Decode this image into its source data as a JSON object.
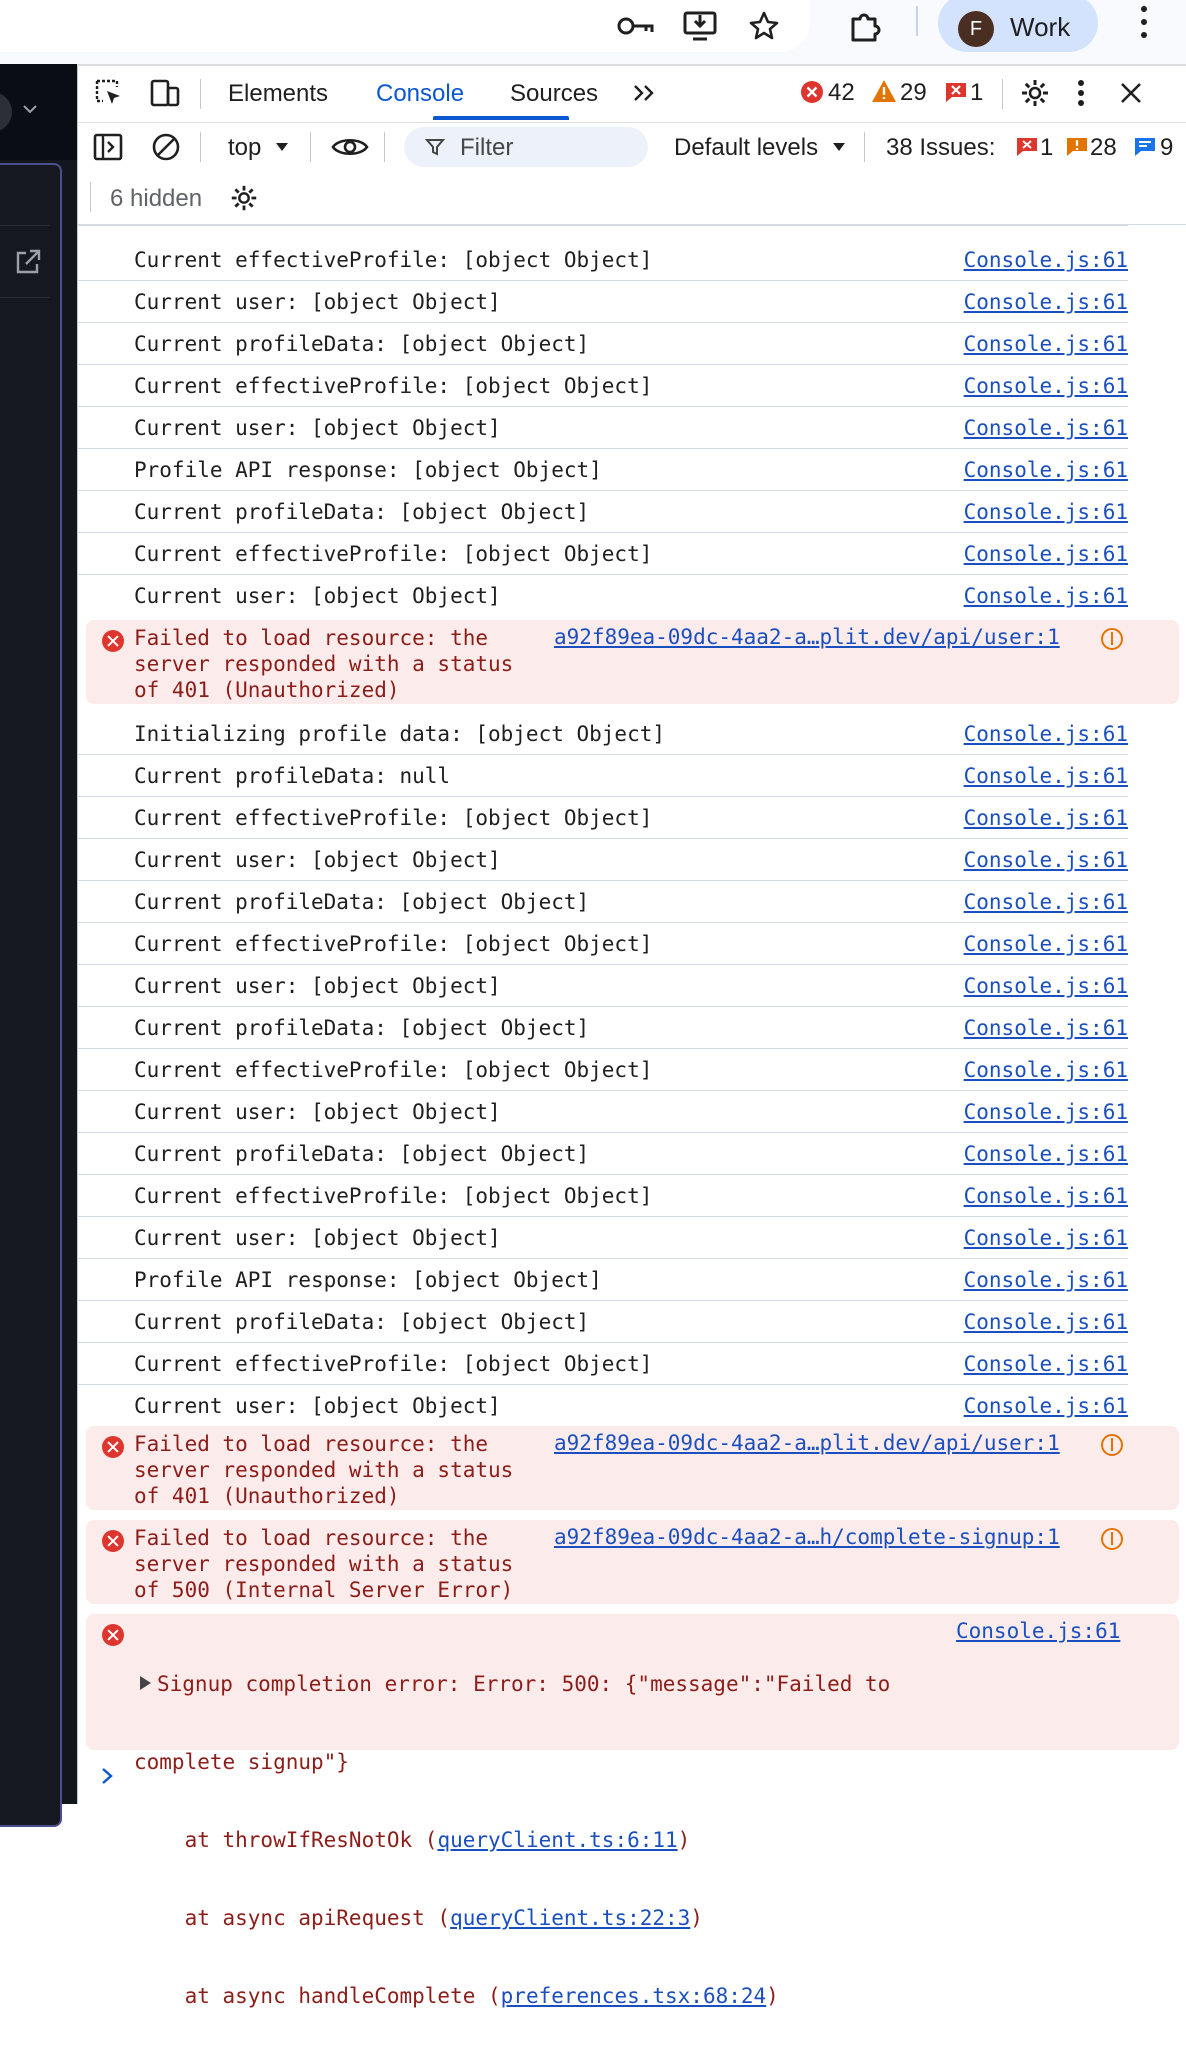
{
  "browser": {
    "profile_initial": "F",
    "profile_name": "Work"
  },
  "devtools": {
    "tabs": [
      "Elements",
      "Console",
      "Sources"
    ],
    "error_count": "42",
    "warning_count": "29",
    "issue_count": "1"
  },
  "toolbar": {
    "context": "top",
    "filter_placeholder": "Filter",
    "levels": "Default levels",
    "issues_label": "38 Issues:",
    "issues_errors": "1",
    "issues_warnings": "28",
    "issues_info": "9",
    "hidden_label": "6 hidden"
  },
  "colors": {
    "accent": "#0b57d0",
    "error_bg": "#fcebeb",
    "error_text": "#8c1d18",
    "error_icon": "#dc362e",
    "warning_icon": "#e37400"
  },
  "console": {
    "rows": [
      {
        "msg": "Current effectiveProfile: [object Object]",
        "src": "Console.js:61"
      },
      {
        "msg": "Current user: [object Object]",
        "src": "Console.js:61"
      },
      {
        "msg": "Current profileData: [object Object]",
        "src": "Console.js:61"
      },
      {
        "msg": "Current effectiveProfile: [object Object]",
        "src": "Console.js:61"
      },
      {
        "msg": "Current user: [object Object]",
        "src": "Console.js:61"
      },
      {
        "msg": "Profile API response: [object Object]",
        "src": "Console.js:61"
      },
      {
        "msg": "Current profileData: [object Object]",
        "src": "Console.js:61"
      },
      {
        "msg": "Current effectiveProfile: [object Object]",
        "src": "Console.js:61"
      },
      {
        "msg": "Current user: [object Object]",
        "src": "Console.js:61"
      }
    ],
    "error1": {
      "line1": "Failed to load resource: the",
      "line2": "server responded with a status",
      "line3": "of 401 (Unauthorized)",
      "src": "a92f89ea-09dc-4aa2-a…plit.dev/api/user:1"
    },
    "rows2": [
      {
        "msg": "Initializing profile data: [object Object]",
        "src": "Console.js:61"
      },
      {
        "msg": "Current profileData: null",
        "src": "Console.js:61"
      },
      {
        "msg": "Current effectiveProfile: [object Object]",
        "src": "Console.js:61"
      },
      {
        "msg": "Current user: [object Object]",
        "src": "Console.js:61"
      },
      {
        "msg": "Current profileData: [object Object]",
        "src": "Console.js:61"
      },
      {
        "msg": "Current effectiveProfile: [object Object]",
        "src": "Console.js:61"
      },
      {
        "msg": "Current user: [object Object]",
        "src": "Console.js:61"
      },
      {
        "msg": "Current profileData: [object Object]",
        "src": "Console.js:61"
      },
      {
        "msg": "Current effectiveProfile: [object Object]",
        "src": "Console.js:61"
      },
      {
        "msg": "Current user: [object Object]",
        "src": "Console.js:61"
      },
      {
        "msg": "Current profileData: [object Object]",
        "src": "Console.js:61"
      },
      {
        "msg": "Current effectiveProfile: [object Object]",
        "src": "Console.js:61"
      },
      {
        "msg": "Current user: [object Object]",
        "src": "Console.js:61"
      },
      {
        "msg": "Profile API response: [object Object]",
        "src": "Console.js:61"
      },
      {
        "msg": "Current profileData: [object Object]",
        "src": "Console.js:61"
      },
      {
        "msg": "Current effectiveProfile: [object Object]",
        "src": "Console.js:61"
      },
      {
        "msg": "Current user: [object Object]",
        "src": "Console.js:61"
      }
    ],
    "error2": {
      "line1": "Failed to load resource: the",
      "line2": "server responded with a status",
      "line3": "of 401 (Unauthorized)",
      "src": "a92f89ea-09dc-4aa2-a…plit.dev/api/user:1"
    },
    "error3": {
      "line1": "Failed to load resource: the",
      "line2": "server responded with a status",
      "line3": "of 500 (Internal Server Error)",
      "src": "a92f89ea-09dc-4aa2-a…h/complete-signup:1"
    },
    "error4": {
      "line1": "Signup completion error: Error: 500: {\"message\":\"Failed to",
      "line2": "complete signup\"}",
      "stack1_prefix": "    at throwIfResNotOk (",
      "stack1_link": "queryClient.ts:6:11",
      "stack2_prefix": "    at async apiRequest (",
      "stack2_link": "queryClient.ts:22:3",
      "stack3_prefix": "    at async handleComplete (",
      "stack3_link": "preferences.tsx:68:24",
      "close": ")",
      "src": "Console.js:61"
    }
  }
}
